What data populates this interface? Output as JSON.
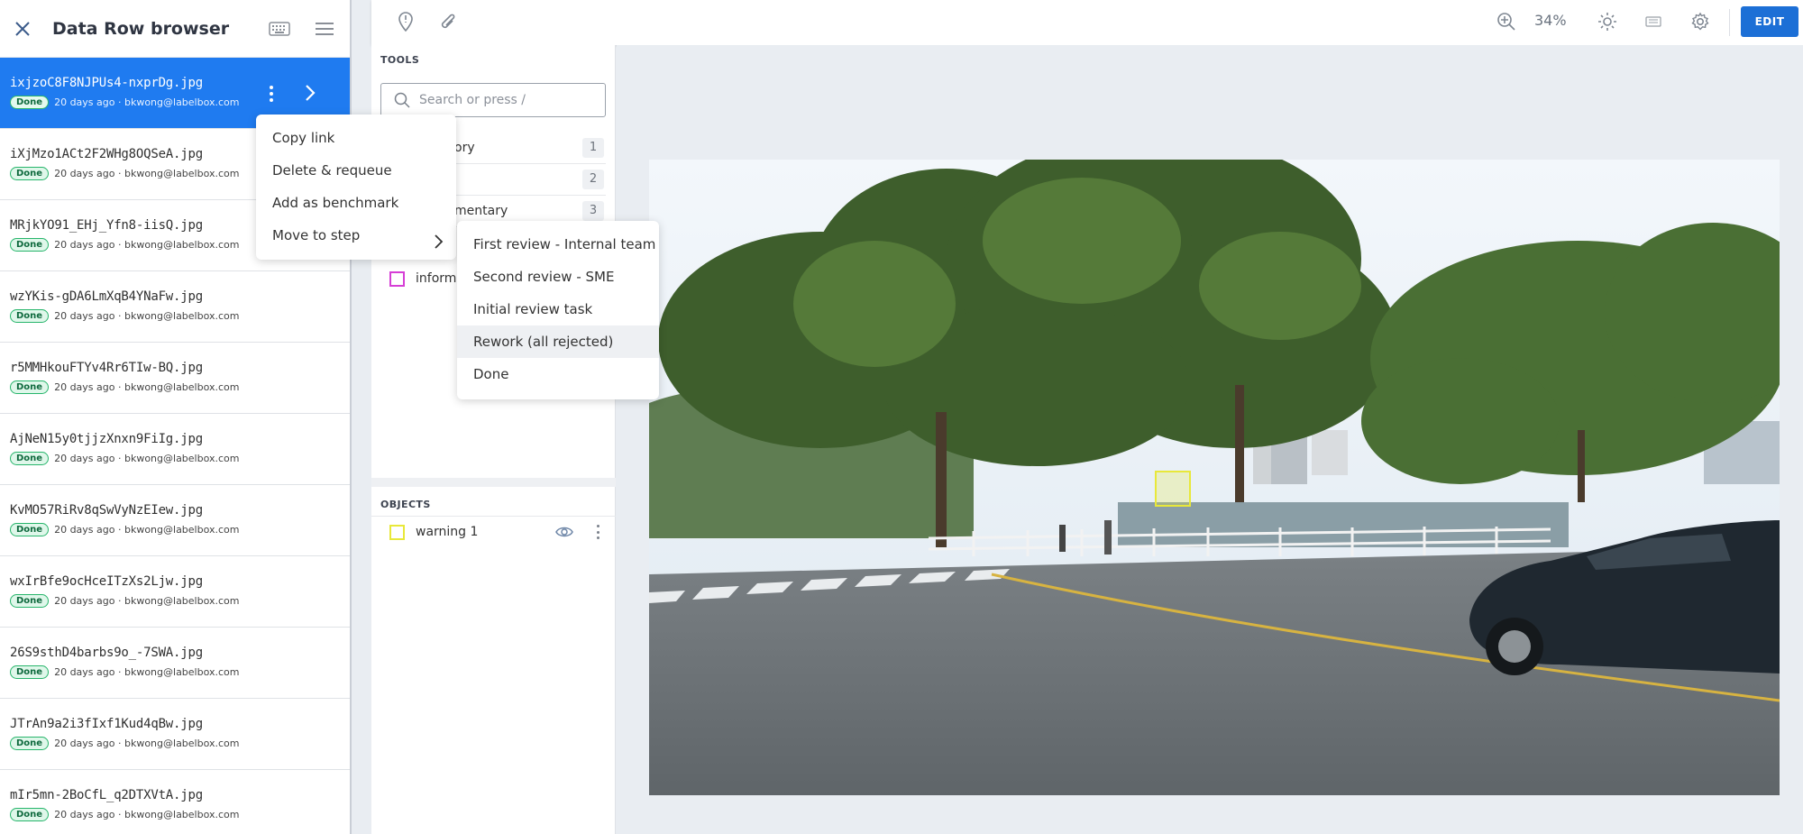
{
  "left_panel": {
    "title": "Data Row browser",
    "rows": [
      {
        "filename": "ixjzoC8F8NJPUs4-nxprDg.jpg",
        "status": "Done",
        "meta": "20 days ago · bkwong@labelbox.com"
      },
      {
        "filename": "iXjMzo1ACt2F2WHg8OQSeA.jpg",
        "status": "Done",
        "meta": "20 days ago · bkwong@labelbox.com"
      },
      {
        "filename": "MRjkYO91_EHj_Yfn8-iisQ.jpg",
        "status": "Done",
        "meta": "20 days ago · bkwong@labelbox.com"
      },
      {
        "filename": "wzYKis-gDA6LmXqB4YNaFw.jpg",
        "status": "Done",
        "meta": "20 days ago · bkwong@labelbox.com"
      },
      {
        "filename": "r5MMHkouFTYv4Rr6TIw-BQ.jpg",
        "status": "Done",
        "meta": "20 days ago · bkwong@labelbox.com"
      },
      {
        "filename": "AjNeN15y0tjjzXnxn9FiIg.jpg",
        "status": "Done",
        "meta": "20 days ago · bkwong@labelbox.com"
      },
      {
        "filename": "KvMO57RiRv8qSwVyNzEIew.jpg",
        "status": "Done",
        "meta": "20 days ago · bkwong@labelbox.com"
      },
      {
        "filename": "wxIrBfe9ocHceITzXs2Ljw.jpg",
        "status": "Done",
        "meta": "20 days ago · bkwong@labelbox.com"
      },
      {
        "filename": "26S9sthD4barbs9o_-7SWA.jpg",
        "status": "Done",
        "meta": "20 days ago · bkwong@labelbox.com"
      },
      {
        "filename": "JTrAn9a2i3fIxf1Kud4qBw.jpg",
        "status": "Done",
        "meta": "20 days ago · bkwong@labelbox.com"
      },
      {
        "filename": "mIr5mn-2BoCfL_q2DTXVtA.jpg",
        "status": "Done",
        "meta": "20 days ago · bkwong@labelbox.com"
      }
    ]
  },
  "context_menu": {
    "items": [
      "Copy link",
      "Delete & requeue",
      "Add as benchmark",
      "Move to step"
    ]
  },
  "submenu": {
    "items": [
      "First review - Internal team",
      "Second review - SME",
      "Initial review task",
      "Rework (all rejected)",
      "Done"
    ],
    "highlighted": "Rework (all rejected)"
  },
  "toolbar": {
    "zoom": "34%",
    "edit_label": "EDIT",
    "icons": [
      "pin-icon",
      "paperclip-icon",
      "zoom-in-icon",
      "brightness-icon",
      "keyboard-icon",
      "settings-icon"
    ]
  },
  "tools_panel": {
    "heading": "TOOLS",
    "search_placeholder": "Search or press /",
    "tools": [
      {
        "name": "ory",
        "count": "1"
      },
      {
        "name": "",
        "count": "2"
      },
      {
        "name": "mentary",
        "count": "3"
      }
    ],
    "info_label": "informa",
    "objects_heading": "OBJECTS",
    "objects": [
      {
        "name": "warning 1",
        "color": "#e8e83a"
      }
    ]
  },
  "colors": {
    "accent": "#1f7bf0",
    "edit_button": "#1c6fd6",
    "info_square": "#d63fd6",
    "warning_square": "#e8e83a"
  }
}
